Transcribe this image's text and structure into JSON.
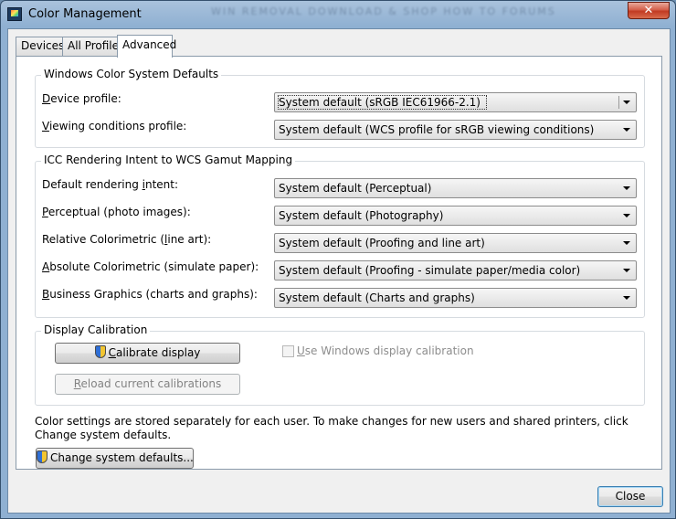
{
  "window": {
    "title": "Color Management",
    "background_text": "WIN REMOVAL DOWNLOAD & SHOP HOW TO FORUMS",
    "close_symbol": "✕"
  },
  "tabs": [
    {
      "label": "Devices",
      "selected": false
    },
    {
      "label": "All Profiles",
      "selected": false
    },
    {
      "label": "Advanced",
      "selected": true
    }
  ],
  "wcs_defaults": {
    "title": "Windows Color System Defaults",
    "rows": [
      {
        "label_u": "D",
        "label_rest": "evice profile:",
        "value": "System default (sRGB IEC61966-2.1)"
      },
      {
        "label_u": "V",
        "label_rest": "iewing conditions profile:",
        "value": "System default (WCS profile for sRGB viewing conditions)"
      }
    ]
  },
  "icc_mapping": {
    "title": "ICC Rendering Intent to WCS Gamut Mapping",
    "rows": [
      {
        "label_pre": "Default rendering ",
        "label_u": "i",
        "label_rest": "ntent:",
        "value": "System default (Perceptual)"
      },
      {
        "label_pre": "",
        "label_u": "P",
        "label_rest": "erceptual (photo images):",
        "value": "System default (Photography)"
      },
      {
        "label_pre": "Relative Colorimetric (",
        "label_u": "l",
        "label_rest": "ine art):",
        "value": "System default (Proofing and line art)"
      },
      {
        "label_pre": "",
        "label_u": "A",
        "label_rest": "bsolute Colorimetric (simulate paper):",
        "value": "System default (Proofing - simulate paper/media color)"
      },
      {
        "label_pre": "",
        "label_u": "B",
        "label_rest": "usiness Graphics (charts and graphs):",
        "value": "System default (Charts and graphs)"
      }
    ]
  },
  "calibration": {
    "title": "Display Calibration",
    "calibrate_u": "C",
    "calibrate_rest": "alibrate display",
    "reload_u": "R",
    "reload_rest": "eload current calibrations",
    "use_windows_u": "U",
    "use_windows_rest": "se Windows display calibration",
    "use_windows_checked": false
  },
  "footer": {
    "info_text": "Color settings are stored separately for each user. To make changes for new users and shared printers, click Change system defaults.",
    "change_defaults_label": "Change system defaults...",
    "close_label": "Close"
  }
}
